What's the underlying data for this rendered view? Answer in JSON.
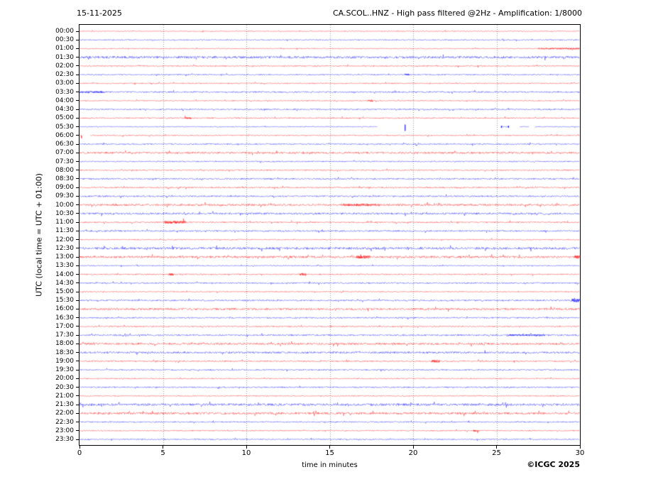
{
  "header": {
    "date": "15-11-2025",
    "title": "CA.SCOL..HNZ - High pass filtered @2Hz - Amplification: 1/8000"
  },
  "footer": {
    "credit": "©ICGC 2025"
  },
  "chart_data": {
    "type": "line",
    "subtype": "helicorder-seismogram",
    "title": "CA.SCOL..HNZ - High pass filtered @2Hz - Amplification: 1/8000",
    "date": "15-11-2025",
    "station": "CA.SCOL..HNZ",
    "filter": "High pass filtered @2Hz",
    "amplification": "1/8000",
    "xlabel": "time in minutes",
    "ylabel": "UTC (local time = UTC + 01:00)",
    "xlim": [
      0,
      30
    ],
    "xticks": [
      0,
      5,
      10,
      15,
      20,
      25,
      30
    ],
    "minutes_per_row": 30,
    "grid": "vertical-dotted-at-5min",
    "legend_position": "none",
    "colors": {
      "red": "#ff0000",
      "blue": "#0000ff",
      "grid": "#999999",
      "axis": "#000000"
    },
    "rows": [
      {
        "t": "00:00",
        "c": "r",
        "a": 0.6
      },
      {
        "t": "00:30",
        "c": "b",
        "a": 0.7
      },
      {
        "t": "01:00",
        "c": "r",
        "a": 0.6,
        "bursts": [
          [
            27.5,
            30,
            1.0
          ]
        ]
      },
      {
        "t": "01:30",
        "c": "b",
        "a": 1.6
      },
      {
        "t": "02:00",
        "c": "r",
        "a": 0.8
      },
      {
        "t": "02:30",
        "c": "b",
        "a": 0.8,
        "bursts": [
          [
            19.5,
            19.8,
            1.4
          ]
        ]
      },
      {
        "t": "03:00",
        "c": "r",
        "a": 0.7
      },
      {
        "t": "03:30",
        "c": "b",
        "a": 1.0,
        "bursts": [
          [
            0,
            1.5,
            1.3
          ]
        ]
      },
      {
        "t": "04:00",
        "c": "r",
        "a": 0.7,
        "bursts": [
          [
            17.3,
            17.6,
            1.4
          ]
        ]
      },
      {
        "t": "04:30",
        "c": "b",
        "a": 0.9
      },
      {
        "t": "05:00",
        "c": "r",
        "a": 0.8,
        "bursts": [
          [
            6.3,
            6.7,
            1.2
          ]
        ]
      },
      {
        "t": "05:30",
        "c": "b",
        "a": 0.6,
        "seg": [
          [
            0,
            17.85
          ],
          [
            25.25,
            25.75
          ],
          [
            26.4,
            26.95
          ],
          [
            27.3,
            30
          ]
        ],
        "spikes": [
          {
            "t": 19.52,
            "u": 3,
            "d": 6
          },
          {
            "t": 25.3,
            "u": 1.5,
            "d": 1.5
          },
          {
            "t": 25.72,
            "u": 1.5,
            "d": 1.5
          }
        ]
      },
      {
        "t": "06:00",
        "c": "r",
        "a": 0.7,
        "seg": [
          [
            0,
            0.1
          ],
          [
            0.65,
            30
          ]
        ],
        "spikes": [
          {
            "t": 0.12,
            "u": 0,
            "d": 4
          }
        ]
      },
      {
        "t": "06:30",
        "c": "b",
        "a": 0.9
      },
      {
        "t": "07:00",
        "c": "r",
        "a": 1.3
      },
      {
        "t": "07:30",
        "c": "b",
        "a": 0.8
      },
      {
        "t": "08:00",
        "c": "r",
        "a": 0.8
      },
      {
        "t": "08:30",
        "c": "b",
        "a": 1.0
      },
      {
        "t": "09:00",
        "c": "r",
        "a": 0.9
      },
      {
        "t": "09:30",
        "c": "b",
        "a": 1.0
      },
      {
        "t": "10:00",
        "c": "r",
        "a": 1.4,
        "bursts": [
          [
            15.8,
            18.0,
            1.7
          ]
        ]
      },
      {
        "t": "10:30",
        "c": "b",
        "a": 1.3
      },
      {
        "t": "11:00",
        "c": "r",
        "a": 0.9,
        "bursts": [
          [
            5.1,
            6.4,
            2.0
          ]
        ]
      },
      {
        "t": "11:30",
        "c": "b",
        "a": 1.0
      },
      {
        "t": "12:00",
        "c": "r",
        "a": 0.7
      },
      {
        "t": "12:30",
        "c": "b",
        "a": 1.6
      },
      {
        "t": "13:00",
        "c": "r",
        "a": 1.5,
        "bursts": [
          [
            16.6,
            17.4,
            2.2
          ],
          [
            29.7,
            30,
            2.4
          ]
        ]
      },
      {
        "t": "13:30",
        "c": "b",
        "a": 0.7
      },
      {
        "t": "14:00",
        "c": "r",
        "a": 0.8,
        "bursts": [
          [
            5.35,
            5.65,
            1.7
          ],
          [
            13.2,
            13.6,
            1.7
          ]
        ]
      },
      {
        "t": "14:30",
        "c": "b",
        "a": 0.9
      },
      {
        "t": "15:00",
        "c": "r",
        "a": 0.7
      },
      {
        "t": "15:30",
        "c": "b",
        "a": 1.0,
        "bursts": [
          [
            29.5,
            30,
            2.4
          ]
        ]
      },
      {
        "t": "16:00",
        "c": "r",
        "a": 1.4
      },
      {
        "t": "16:30",
        "c": "b",
        "a": 0.9
      },
      {
        "t": "17:00",
        "c": "r",
        "a": 0.8
      },
      {
        "t": "17:30",
        "c": "b",
        "a": 1.0,
        "bursts": [
          [
            25.6,
            27.9,
            1.2
          ]
        ]
      },
      {
        "t": "18:00",
        "c": "r",
        "a": 1.4
      },
      {
        "t": "18:30",
        "c": "b",
        "a": 1.3
      },
      {
        "t": "19:00",
        "c": "r",
        "a": 0.9,
        "bursts": [
          [
            21.1,
            21.6,
            1.7
          ]
        ]
      },
      {
        "t": "19:30",
        "c": "b",
        "a": 0.9
      },
      {
        "t": "20:00",
        "c": "r",
        "a": 0.7
      },
      {
        "t": "20:30",
        "c": "b",
        "a": 0.9
      },
      {
        "t": "21:00",
        "c": "r",
        "a": 0.7
      },
      {
        "t": "21:30",
        "c": "b",
        "a": 1.6
      },
      {
        "t": "22:00",
        "c": "r",
        "a": 1.5
      },
      {
        "t": "22:30",
        "c": "b",
        "a": 0.8
      },
      {
        "t": "23:00",
        "c": "r",
        "a": 0.7,
        "bursts": [
          [
            23.6,
            23.9,
            1.4
          ]
        ]
      },
      {
        "t": "23:30",
        "c": "b",
        "a": 0.8
      }
    ]
  }
}
